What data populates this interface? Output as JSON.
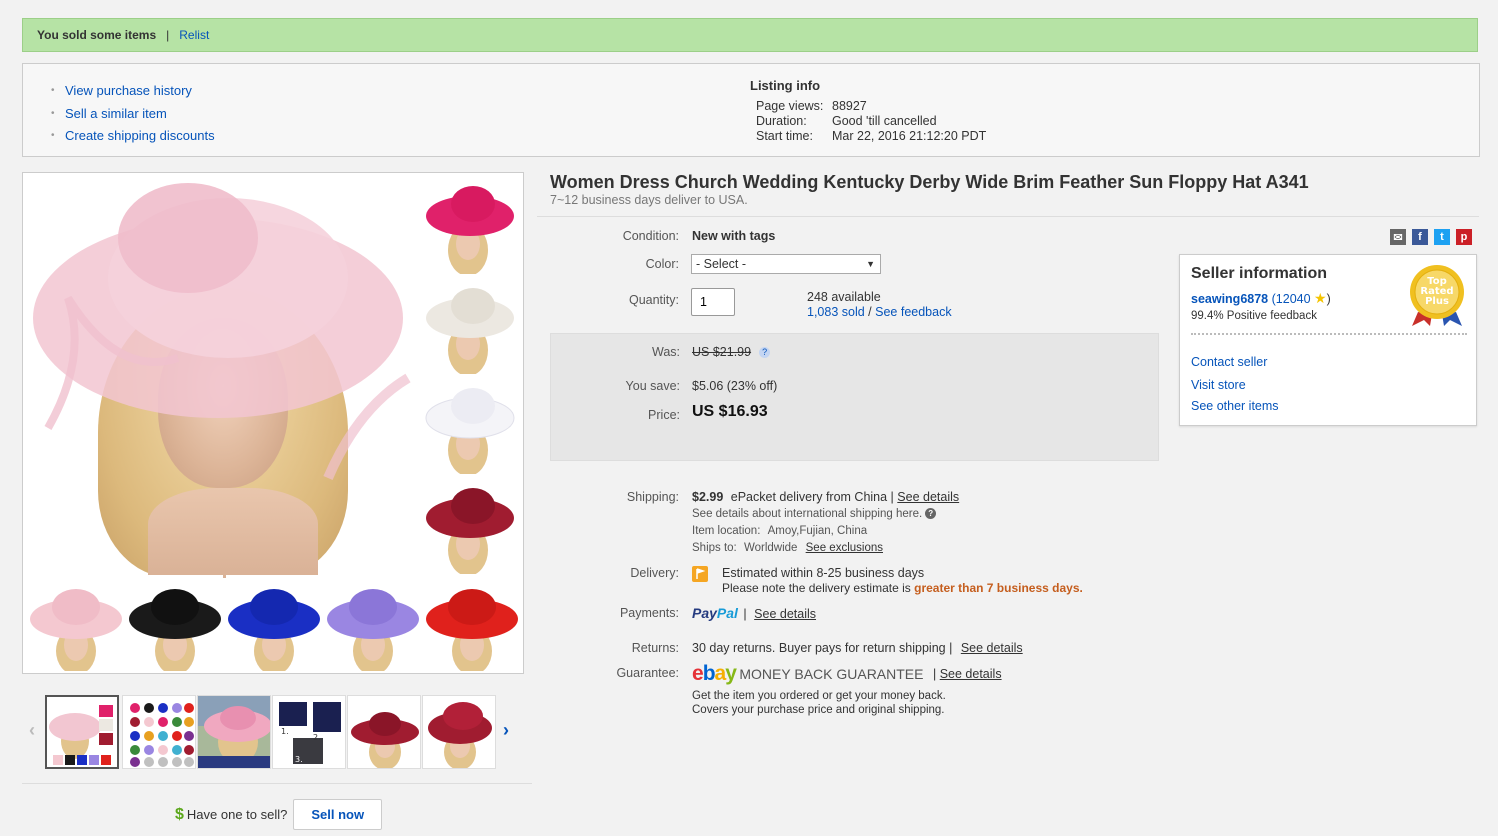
{
  "banner": {
    "sold_text": "You sold some items",
    "separator": "|",
    "relist": "Relist"
  },
  "actions": [
    "View purchase history",
    "Sell a similar item",
    "Create shipping discounts"
  ],
  "listing_info": {
    "heading": "Listing info",
    "page_views_label": "Page views:",
    "page_views": "88927",
    "duration_label": "Duration:",
    "duration": "Good 'till cancelled",
    "start_label": "Start time:",
    "start": "Mar 22, 2016 21:12:20 PDT"
  },
  "item": {
    "title": "Women Dress Church Wedding Kentucky Derby Wide Brim Feather Sun Floppy Hat A341",
    "subtitle": "7~12 business days deliver to USA."
  },
  "form": {
    "condition_label": "Condition:",
    "condition": "New with tags",
    "color_label": "Color:",
    "color_value": "- Select -",
    "quantity_label": "Quantity:",
    "quantity": "1",
    "available": "248 available",
    "sold": "1,083 sold",
    "slash": "/",
    "feedback": "See feedback"
  },
  "price": {
    "was_label": "Was:",
    "was": "US $21.99",
    "save_label": "You save:",
    "save": "$5.06 (23% off)",
    "price_label": "Price:",
    "price": "US $16.93"
  },
  "shipping": {
    "label": "Shipping:",
    "cost": "$2.99",
    "method": "ePacket delivery from China |",
    "details": "See details",
    "intl": "See details about international shipping here.",
    "location_label": "Item location:",
    "location": "Amoy,Fujian, China",
    "ships_label": "Ships to:",
    "ships": "Worldwide",
    "exclusions": "See exclusions"
  },
  "delivery": {
    "label": "Delivery:",
    "estimate": "Estimated within 8-25 business days",
    "note": "Please note the delivery estimate is",
    "note_emph": "greater than 7 business days."
  },
  "payments": {
    "label": "Payments:",
    "pay": "Pay",
    "pal": "Pal",
    "sep": "|",
    "details": "See details"
  },
  "returns": {
    "label": "Returns:",
    "text": "30 day returns. Buyer pays for return shipping |",
    "details": "See details"
  },
  "guarantee": {
    "label": "Guarantee:",
    "e": "e",
    "b": "b",
    "a": "a",
    "y": "y",
    "mbg": "MONEY BACK GUARANTEE",
    "sep": "|",
    "details": "See details",
    "line1": "Get the item you ordered or get your money back.",
    "line2": "Covers your purchase price and original shipping."
  },
  "seller": {
    "heading": "Seller information",
    "name": "seawing6878",
    "score": "(12040",
    "score_close": ")",
    "positive": "99.4% Positive feedback",
    "contact": "Contact seller",
    "store": "Visit store",
    "other": "See other items",
    "badge_line1": "Top",
    "badge_line2": "Rated",
    "badge_line3": "Plus"
  },
  "sell": {
    "dollar": "$",
    "question": "Have one to sell?",
    "button": "Sell now"
  },
  "share_icons": {
    "mail": "✉",
    "facebook": "f",
    "twitter": "t",
    "pinterest": "p"
  },
  "colors": {
    "main_hat": "#f2c6d1",
    "pink": "#e0216a",
    "cream": "#ece8e1",
    "white": "#f4f4f8",
    "wine": "#a01c30",
    "lightpink": "#f4c8d0",
    "black": "#1a1a1a",
    "blue": "#1a2fc4",
    "lavender": "#9a86e2",
    "red": "#e0211c"
  }
}
